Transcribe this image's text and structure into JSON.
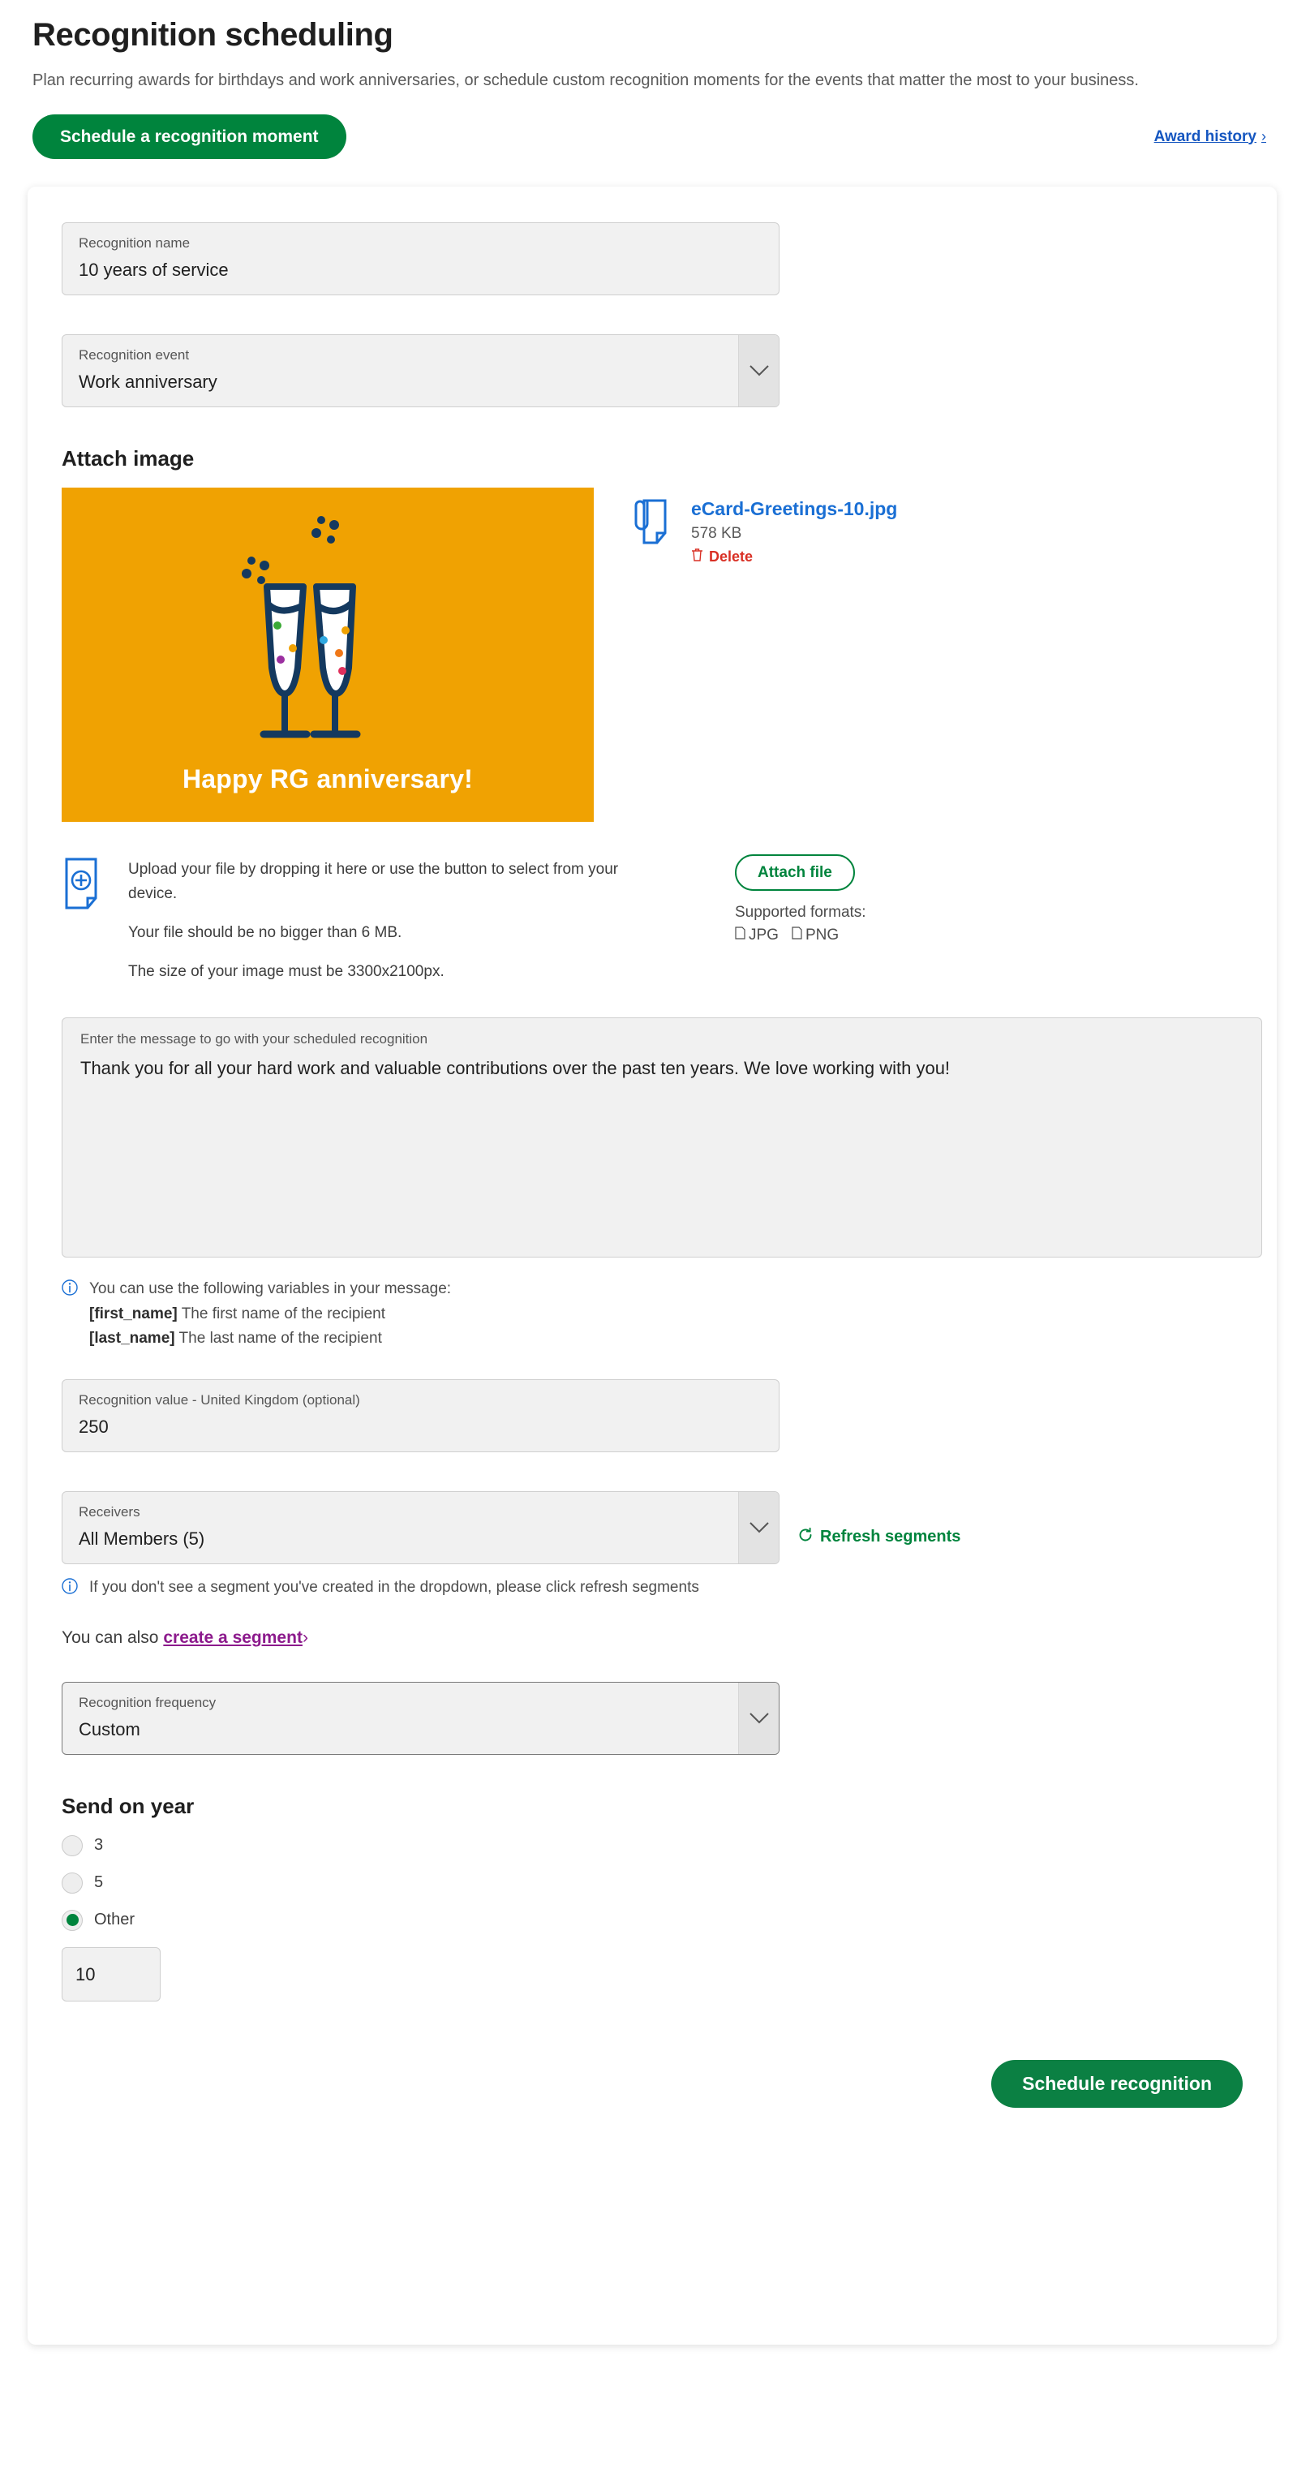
{
  "header": {
    "title": "Recognition scheduling",
    "subtitle": "Plan recurring awards for birthdays and work anniversaries, or schedule custom recognition moments for the events that matter the most to your business.",
    "primary_button": "Schedule a recognition moment",
    "award_history_link": "Award history",
    "award_history_chevron": "›"
  },
  "form": {
    "recognition_name": {
      "label": "Recognition name",
      "value": "10 years of service"
    },
    "recognition_event": {
      "label": "Recognition event",
      "value": "Work anniversary"
    },
    "attach_image": {
      "section_title": "Attach image",
      "ecard_caption": "Happy RG anniversary!",
      "file_name": "eCard-Greetings-10.jpg",
      "file_size": "578 KB",
      "delete_label": "Delete"
    },
    "dropzone": {
      "line1": "Upload your file by dropping it here or use the button to select from your device.",
      "line2": "Your file should be no bigger than 6 MB.",
      "line3": "The size of your image must be 3300x2100px.",
      "attach_button": "Attach file",
      "formats_title": "Supported formats:",
      "format_jpg": "JPG",
      "format_png": "PNG"
    },
    "message": {
      "label": "Enter the message to go with your scheduled recognition",
      "value": "Thank you for all your hard work and valuable contributions over the past ten years. We love working with you!"
    },
    "variables_hint": {
      "intro": "You can use the following variables in your message:",
      "first_name_token": "[first_name]",
      "first_name_desc": "The first name of the recipient",
      "last_name_token": "[last_name]",
      "last_name_desc": "The last name of the recipient"
    },
    "recognition_value": {
      "label": "Recognition value - United Kingdom (optional)",
      "value": "250"
    },
    "receivers": {
      "label": "Receivers",
      "value": "All Members (5)",
      "refresh_label": "Refresh segments"
    },
    "segment_hint": "If you don't see a segment you've created in the dropdown, please click refresh segments",
    "create_segment": {
      "prefix": "You can also",
      "link": "create a segment",
      "chevron": "›"
    },
    "recognition_frequency": {
      "label": "Recognition frequency",
      "value": "Custom"
    },
    "send_on_year": {
      "title": "Send on year",
      "options": [
        {
          "label": "3",
          "checked": false
        },
        {
          "label": "5",
          "checked": false
        },
        {
          "label": "Other",
          "checked": true
        }
      ],
      "other_value": "10"
    },
    "submit_button": "Schedule recognition"
  },
  "colors": {
    "brand_green": "#00843D",
    "link_blue": "#1a6fd4",
    "delete_red": "#d93025",
    "segment_purple": "#8c1a8c",
    "ecard_orange": "#F0A202",
    "ecard_navy": "#14395F"
  }
}
